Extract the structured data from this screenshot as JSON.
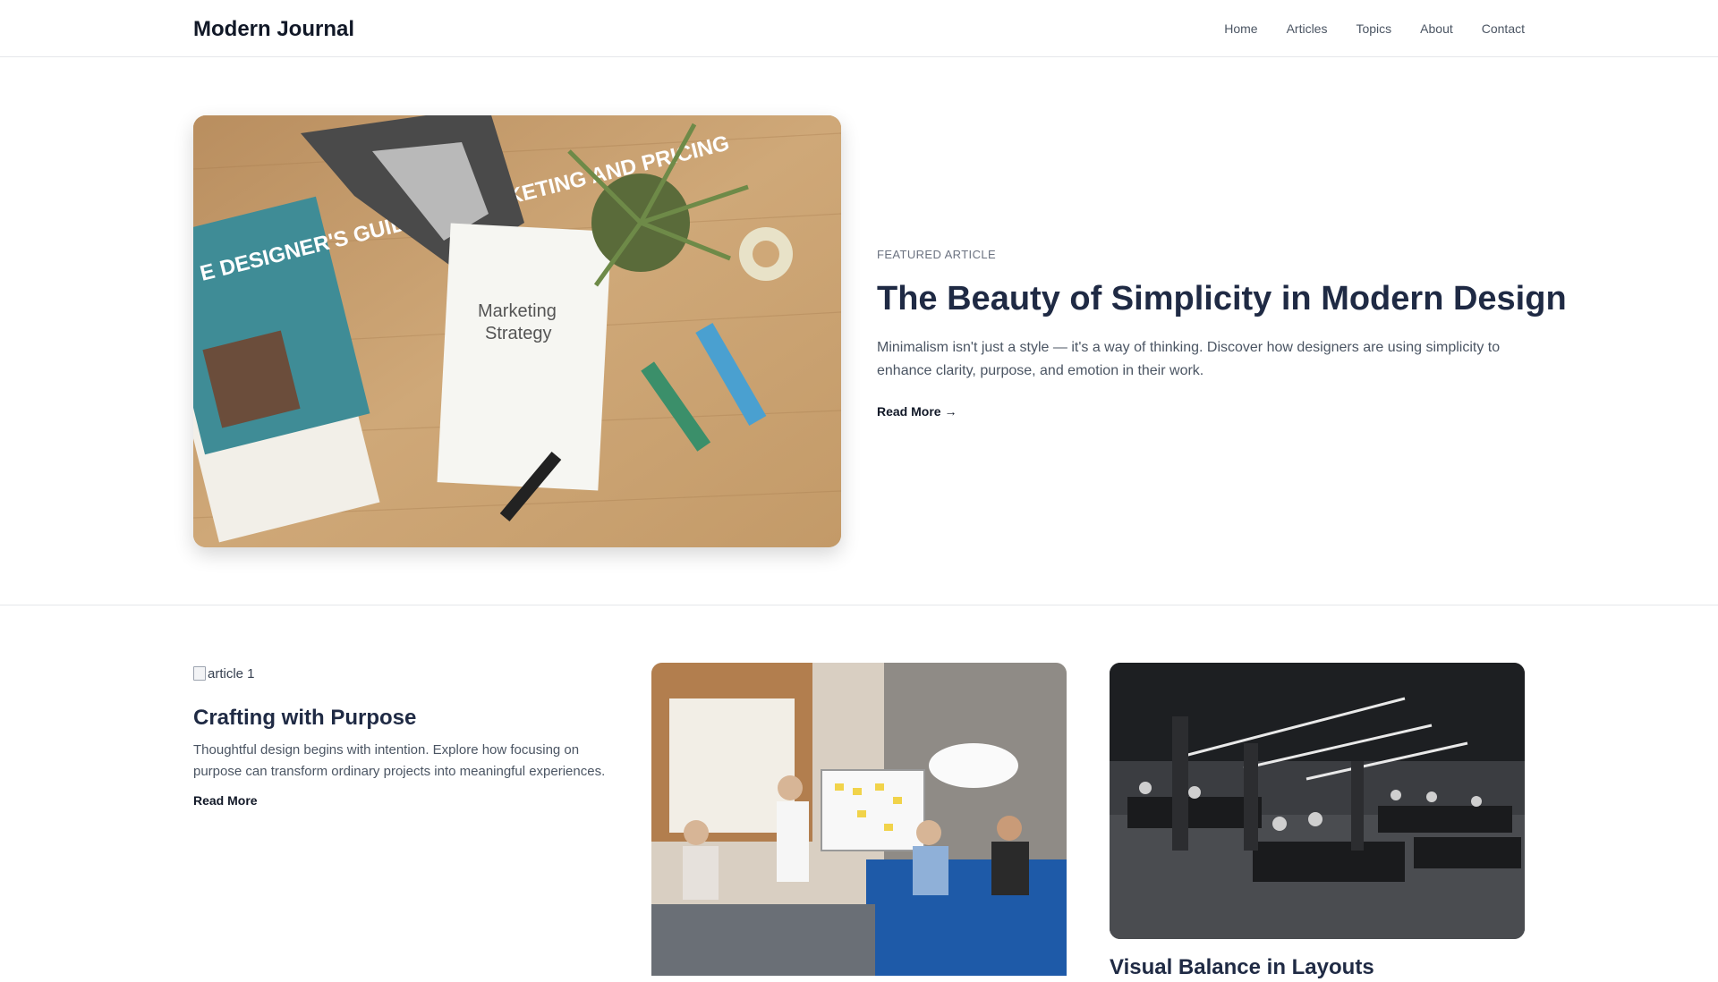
{
  "header": {
    "brand": "Modern Journal",
    "nav": [
      "Home",
      "Articles",
      "Topics",
      "About",
      "Contact"
    ]
  },
  "featured": {
    "eyebrow": "FEATURED ARTICLE",
    "title": "The Beauty of Simplicity in Modern Design",
    "excerpt": "Minimalism isn't just a style — it's a way of thinking. Discover how designers are using simplicity to enhance clarity, purpose, and emotion in their work.",
    "read_more": "Read More →",
    "image": {
      "book_text": "E DESIGNER'S GUIDE TO MARKETING AND PRICING",
      "paper_text_1": "Marketing",
      "paper_text_2": "Strategy"
    }
  },
  "articles": [
    {
      "image_alt": "article 1",
      "title": "Crafting with Purpose",
      "excerpt": "Thoughtful design begins with intention. Explore how focusing on purpose can transform ordinary projects into meaningful experiences.",
      "link": "Read More"
    },
    {
      "image_desc": "team meeting in office"
    },
    {
      "image_desc": "open-plan office",
      "title": "Visual Balance in Layouts"
    }
  ],
  "colors": {
    "title": "#1f2a44",
    "text_muted": "#4b5563",
    "divider": "#e5e7eb"
  }
}
